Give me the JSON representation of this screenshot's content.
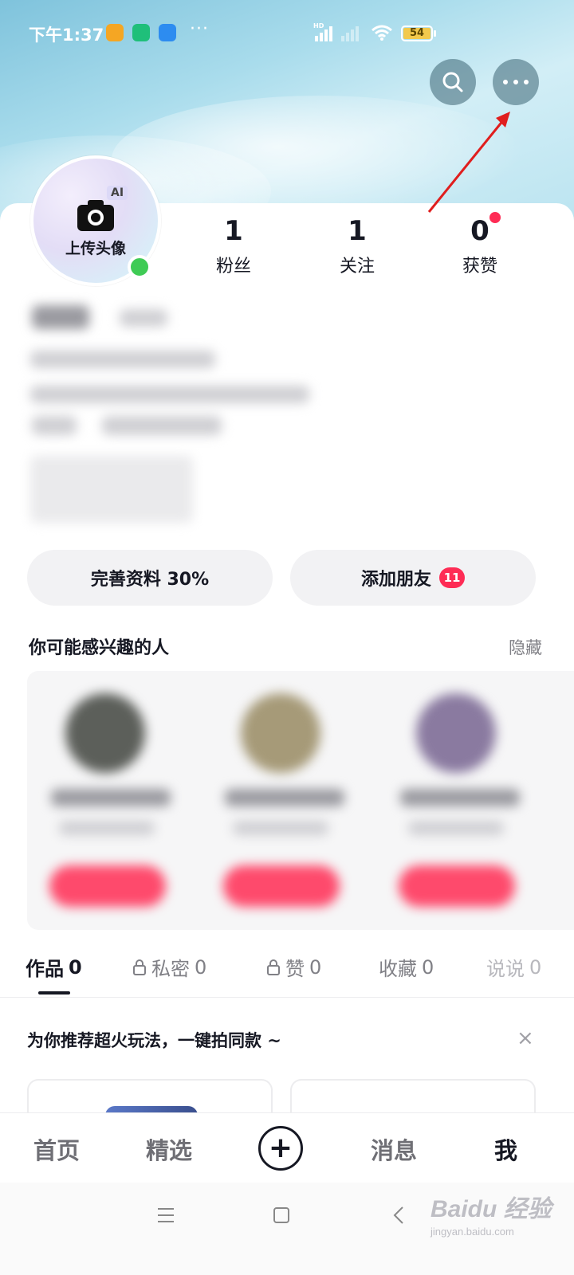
{
  "status_bar": {
    "time": "下午1:37",
    "more": "···",
    "battery": "54",
    "hd_label": "HD"
  },
  "profile": {
    "avatar_label": "上传头像",
    "ai_badge": "AI",
    "stats": [
      {
        "value": "1",
        "label": "粉丝"
      },
      {
        "value": "1",
        "label": "关注"
      },
      {
        "value": "0",
        "label": "获赞"
      }
    ]
  },
  "actions": {
    "complete_profile": "完善资料 30%",
    "add_friends": "添加朋友",
    "add_friends_badge": "11"
  },
  "recommend": {
    "title": "你可能感兴趣的人",
    "hide": "隐藏"
  },
  "tabs": [
    {
      "label": "作品",
      "count": "0",
      "locked": false
    },
    {
      "label": "私密",
      "count": "0",
      "locked": true
    },
    {
      "label": "赞",
      "count": "0",
      "locked": true
    },
    {
      "label": "收藏",
      "count": "0",
      "locked": false
    },
    {
      "label": "说说",
      "count": "0",
      "locked": false
    }
  ],
  "promo": {
    "title": "为你推荐超火玩法，一键拍同款 ~",
    "close": "×"
  },
  "bottom_nav": [
    {
      "label": "首页"
    },
    {
      "label": "精选"
    },
    {
      "label": "消息"
    },
    {
      "label": "我"
    }
  ],
  "watermark": {
    "brand": "Baidu 经验",
    "url": "jingyan.baidu.com"
  }
}
